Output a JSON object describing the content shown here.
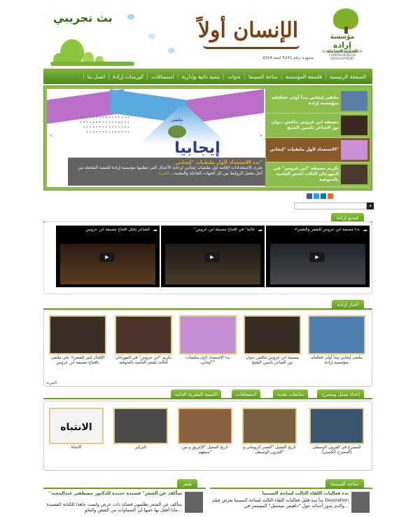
{
  "header": {
    "site_name": "إرادة",
    "site_name_prefix": "مؤسسة",
    "site_name_suffix": "للتنمية الشاملة",
    "site_subtitle": "ERADA FOUNDATION FOR COMPREHENSIVE DEVELOPMENT",
    "center_title": "الإنسان أولاً",
    "issue_text": "مشهرة برقم 5241 لسنة 2014",
    "trial_broadcast": "بث تجريبي"
  },
  "nav": {
    "items": [
      "الصفحة الرئيسية",
      "فلسفة المؤسسة",
      "ساحة السينما",
      "ندوات",
      "تنمية ذاتية وإدارية",
      "استضافات",
      "كورسات إرادة",
      "اتصل بنا"
    ]
  },
  "slider": {
    "slide_logo_small": "ملتقى",
    "slide_logo": "إيجابيا",
    "caption_title": "بدء الاستعداد لأول ملتقيات \"إيجابي\"",
    "caption_body": "تجرى الاستعدادات لإقامة أول ملتقيات إيجابي لرعاية الأعمال التي تنظمها مؤسسة إرادة للتنمية الشاملة من أجل تفعيل الروابط بين كل الجهات الفاعلة والمعنية...",
    "caption_more": "المزيد",
    "thumbs": [
      "ملتقى إيجابي يبدأ أولى فعالياته بمؤسسة إرادة",
      "مصيفة ابن عروس تناقش ديوان نور الشاعر ياسين الشيخ",
      "الاستعداد لأول ملتقيات \"إيجابي\"",
      "تكريم مصيفة \"ابن عروس\" في المهرجان الثالث لشعر العامية بالمنوفية"
    ],
    "active_thumb": 2
  },
  "search": {
    "placeholder": "",
    "button": "»"
  },
  "videos": {
    "title": "فيديو إرادة",
    "items": [
      "الشاعر يحلل افتتاح مصيفة ابن عروس",
      "\"غالية\" في افتتاح مصيفة ابن عروس",
      "بدء مصيفة ابن عروس للشعر والشعراء"
    ],
    "play_label": "▶"
  },
  "news": {
    "title": "أخبار إرادة",
    "items": [
      "ملتقى إيجابي يبدأ أولى فعالياته بمؤسسة إرادة",
      "مصيفة ابن عروس تناقش ديوان نور الشاعر ياسين الشيخ",
      "بدء الاستعداد لأول ملتقيات \"إيجابي\"",
      "تكريم \"ابن عروس\" في المهرجان الثالث لشعر العامية بالمنوفية",
      "الإقبال كبير للشعراء على ملتقى بافتتاح مصيفة ابن عروس"
    ],
    "more": "المزيد"
  },
  "tabs": {
    "items": [
      "إعداد ممثل ومسرح",
      "متابعات نقدية",
      "استضافات",
      "التنمية البشرية الذاتية"
    ],
    "active": 0
  },
  "theatre": {
    "items": [
      "المسرح في القرون الوسطى (المسرح الكنسي)",
      "تاريخ التمثيل \"العصر الرومانى و القرون الوسطى\"",
      "تاريخ التمثيل \"الإغريق و من سبقهم\"",
      "التركيز",
      "الانتباه"
    ],
    "card_text": "الانتباه"
  },
  "cinema": {
    "title": "ساحة السينما",
    "headline": "بدء فعاليات اللقاء الثالث لساحة السينما",
    "body": "بدأ منذ قليل فعاليات اللقاء الثالث لساحة السينما بعرض فيلم Desolation والذي يدور أحداثه حول \"داهيس ميسبيل\" المستمر في..."
  },
  "poetry": {
    "title": "شعر",
    "headline": "\"سأكف عن الشعر\" قصيدة جديدة للدكتور مصطفى عبدالمجيد",
    "body": "سأكف عن الشعر نظلمون قصائد ذات عرض ولست جاهدا للكتابة القصيدة ماذا أفعل بها حينها لي السماوات من الفيض والنحو..."
  }
}
